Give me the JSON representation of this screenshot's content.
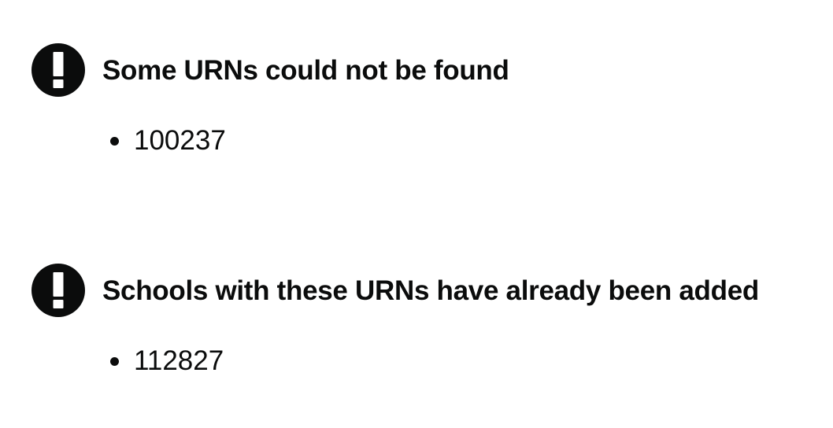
{
  "notices": [
    {
      "title": "Some URNs could not be found",
      "icon": "warning-exclamation-icon",
      "items": [
        "100237"
      ]
    },
    {
      "title": "Schools with these URNs have already been added",
      "icon": "warning-exclamation-icon",
      "items": [
        "112827"
      ]
    }
  ],
  "colors": {
    "text": "#0b0c0c",
    "icon_background": "#0b0c0c",
    "icon_foreground": "#ffffff",
    "page_background": "#ffffff"
  }
}
